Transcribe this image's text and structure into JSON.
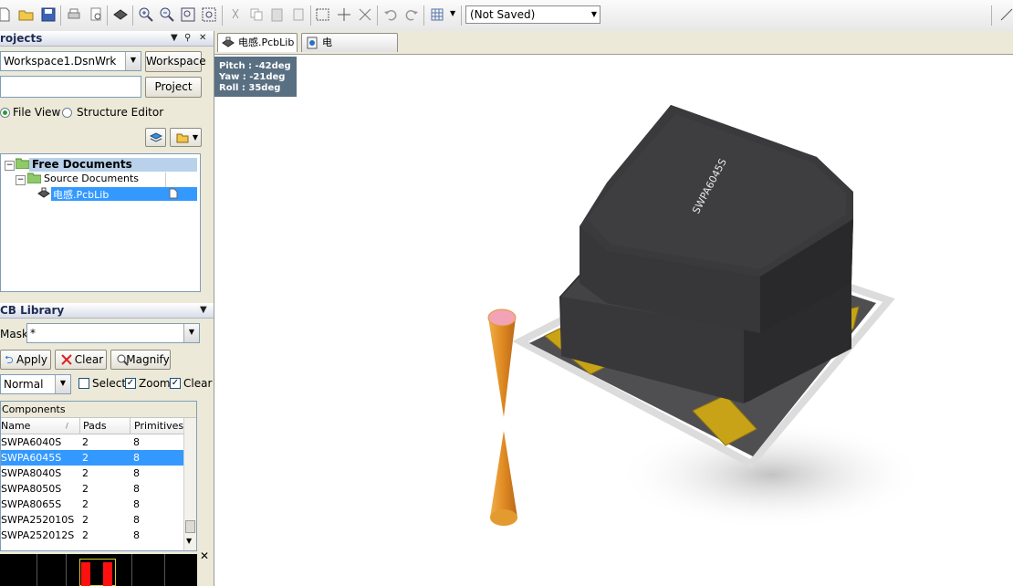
{
  "toolbar": {
    "view_select": "(Not Saved)",
    "icons": [
      "new-icon",
      "open-icon",
      "save-icon",
      "print-icon",
      "print-preview-icon",
      "board-icon",
      "zoom-in-icon",
      "zoom-out-icon",
      "zoom-fit-icon",
      "zoom-area-icon",
      "cut-icon",
      "copy-icon",
      "paste-icon",
      "rubber-stamp-icon",
      "select-area-icon",
      "move-icon",
      "deselect-icon",
      "undo-icon",
      "redo-icon",
      "grid-icon"
    ]
  },
  "projects_panel": {
    "title": "rojects",
    "workspace_value": "Workspace1.DsnWrk",
    "workspace_button": "Workspace",
    "project_value": "",
    "project_button": "Project",
    "file_view_label": "File View",
    "structure_editor_label": "Structure Editor",
    "tree": {
      "root": "Free Documents",
      "group": "Source Documents",
      "item": "电感.PcbLib"
    }
  },
  "pcb_library_panel": {
    "title": "CB Library",
    "mask_label": "Mask",
    "mask_value": "*",
    "apply_label": "Apply",
    "clear_label": "Clear",
    "magnify_label": "Magnify",
    "mode_value": "Normal",
    "select_label": "Select",
    "zoom_label": "Zoom",
    "clear_existing_label": "Clear E",
    "components_header": "Components",
    "columns": [
      "Name",
      "Pads",
      "Primitives"
    ],
    "rows": [
      {
        "name": "SWPA6040S",
        "pads": "2",
        "primitives": "8"
      },
      {
        "name": "SWPA6045S",
        "pads": "2",
        "primitives": "8"
      },
      {
        "name": "SWPA8040S",
        "pads": "2",
        "primitives": "8"
      },
      {
        "name": "SWPA8050S",
        "pads": "2",
        "primitives": "8"
      },
      {
        "name": "SWPA8065S",
        "pads": "2",
        "primitives": "8"
      },
      {
        "name": "SWPA252010S",
        "pads": "2",
        "primitives": "8"
      },
      {
        "name": "SWPA252012S",
        "pads": "2",
        "primitives": "8"
      }
    ],
    "selected_row": 1
  },
  "document_tabs": [
    "电感.PcbLib",
    "电感.PcbLib.htm"
  ],
  "orientation": {
    "pitch": "Pitch : -42deg",
    "yaw": "Yaw : -21deg",
    "roll": "Roll : 35deg"
  },
  "component_marking": "SWPA6045S",
  "colors": {
    "selection": "#3399ff",
    "component_body": "#3a3a3c",
    "pad": "#c8a318",
    "origin_marker": "#e39a2f",
    "orientation_bg": "#596f82"
  }
}
